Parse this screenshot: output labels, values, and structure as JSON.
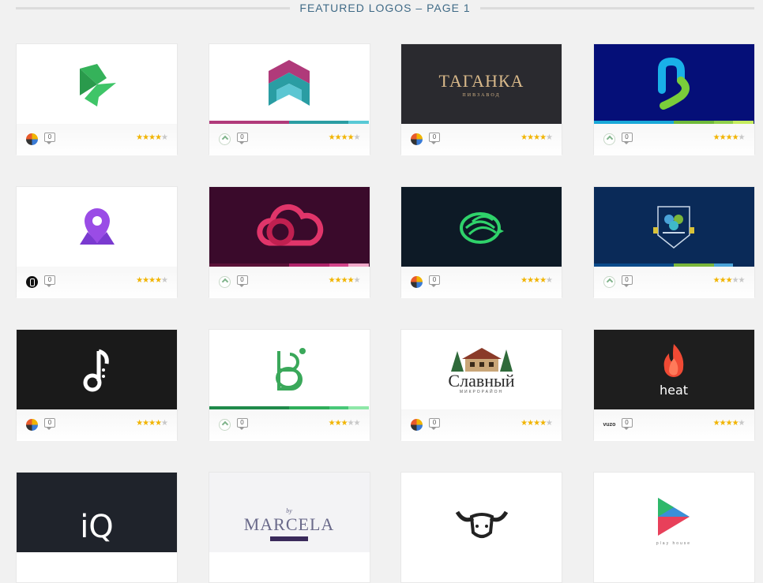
{
  "header": {
    "title": "FEATURED LOGOS – PAGE 1"
  },
  "cards": [
    {
      "name": "green-arrow-logo",
      "bg": "#ffffff",
      "icon": "green-arrow",
      "stripe": [],
      "avatar": "multi",
      "comments": "0",
      "rating": 4.5
    },
    {
      "name": "chevron-shield-logo",
      "bg": "#ffffff",
      "icon": "chevron-shield",
      "stripe": [
        "#b03a7a",
        "#b03a7a",
        "#2a9da3",
        "#2a9da3",
        "#58c9d6"
      ],
      "avatar": "light",
      "comments": "0",
      "rating": 4
    },
    {
      "name": "taganka-logo",
      "bg": "#2a2a2f",
      "icon": "taganka-text",
      "text": "ТАГАНКА",
      "subtext": "ПИВЗАВОД",
      "stripe": [],
      "avatar": "multi",
      "comments": "0",
      "rating": 4
    },
    {
      "name": "blue-snake-logo",
      "bg": "#050f78",
      "icon": "snake-letter",
      "stripe": [
        "#18a8d8",
        "#18a8d8",
        "#6fba3a",
        "#8fd04a",
        "#c5ec5e"
      ],
      "avatar": "light",
      "comments": "0",
      "rating": 4
    },
    {
      "name": "location-pin-logo",
      "bg": "#ffffff",
      "icon": "location-pin",
      "stripe": [],
      "avatar": "dark",
      "comments": "0",
      "rating": 4
    },
    {
      "name": "pink-cloud-logo",
      "bg": "#3a0a2b",
      "icon": "cloud-loop",
      "stripe": [
        "#5a1238",
        "#5a1238",
        "#b0246a",
        "#d3448a",
        "#f0a8c8"
      ],
      "avatar": "light",
      "comments": "0",
      "rating": 4.5
    },
    {
      "name": "hedgehog-logo",
      "bg": "#0d1a26",
      "icon": "hedgehog",
      "stripe": [],
      "avatar": "multi",
      "comments": "0",
      "rating": 4.5
    },
    {
      "name": "clover-badge-logo",
      "bg": "#0a2a58",
      "icon": "clover-badge",
      "stripe": [
        "#0a4a8a",
        "#0a4a8a",
        "#7ab63a",
        "#4aa3d8",
        "#0a2a58"
      ],
      "avatar": "light",
      "comments": "0",
      "rating": 3.5
    },
    {
      "name": "music-note-logo",
      "bg": "#1a1a1a",
      "icon": "music-note",
      "stripe": [],
      "avatar": "multi",
      "comments": "0",
      "rating": 4
    },
    {
      "name": "letter-b-logo",
      "bg": "#ffffff",
      "icon": "letter-b",
      "stripe": [
        "#1f8a4a",
        "#1f8a4a",
        "#2fae5a",
        "#48c878",
        "#8ee8a8"
      ],
      "avatar": "light",
      "comments": "0",
      "rating": 3.5
    },
    {
      "name": "slavny-logo",
      "bg": "#ffffff",
      "icon": "house-scene",
      "text": "Славный",
      "subtext": "МИКРОРАЙОН",
      "stripe": [],
      "avatar": "multi",
      "comments": "0",
      "rating": 4
    },
    {
      "name": "heat-logo",
      "bg": "#1e1e1e",
      "icon": "flame",
      "text": "heat",
      "stripe": [],
      "avatar": "text",
      "avatarText": "vuzo",
      "comments": "0",
      "rating": 4
    },
    {
      "name": "iq-logo",
      "bg": "#1f232b",
      "icon": "iq-text",
      "text": "iQ",
      "stripe": [],
      "avatar": "none",
      "comments": "",
      "rating": 0
    },
    {
      "name": "marcela-logo",
      "bg": "#f3f3f5",
      "icon": "marcela-text",
      "text": "MARCELA",
      "subtext": "by",
      "stripe": [],
      "avatar": "none",
      "comments": "",
      "rating": 0
    },
    {
      "name": "buffalo-logo",
      "bg": "#ffffff",
      "icon": "buffalo",
      "stripe": [],
      "avatar": "none",
      "comments": "",
      "rating": 0
    },
    {
      "name": "play-house-logo",
      "bg": "#ffffff",
      "icon": "play-triangle",
      "text": "play house",
      "stripe": [],
      "avatar": "none",
      "comments": "",
      "rating": 0
    }
  ]
}
